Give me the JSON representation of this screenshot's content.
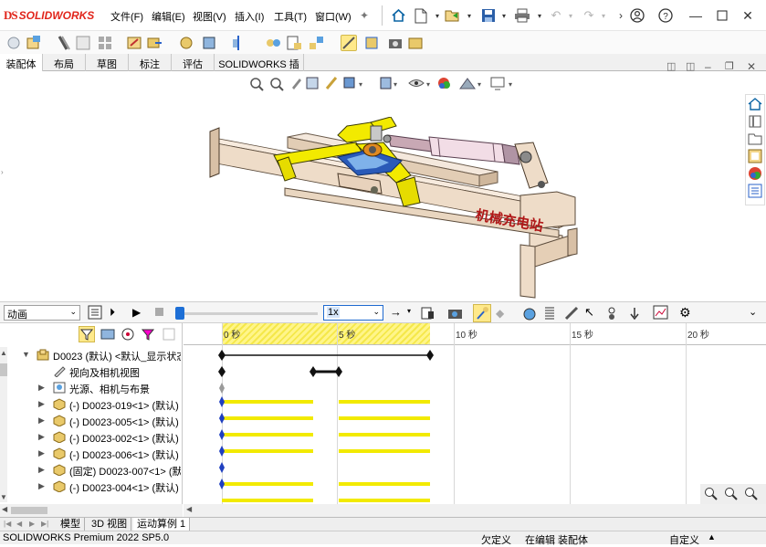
{
  "app": {
    "logo_ds": "DS",
    "logo_text": "SOLIDWORKS",
    "menus": [
      "文件(F)",
      "编辑(E)",
      "视图(V)",
      "插入(I)",
      "工具(T)",
      "窗口(W)"
    ]
  },
  "tabs": [
    "装配体",
    "布局",
    "草图",
    "标注",
    "评估",
    "SOLIDWORKS 插件"
  ],
  "viewport": {
    "watermark": "机械充电站"
  },
  "motion": {
    "study_type": "动画",
    "speed": "1x",
    "ticks": [
      "0 秒",
      "5 秒",
      "10 秒",
      "15 秒",
      "20 秒"
    ]
  },
  "tree": {
    "rows": [
      {
        "label": "D0023 (默认) <默认_显示状态",
        "arrow": "▼",
        "icon": "assembly"
      },
      {
        "label": "视向及相机视图",
        "arrow": "",
        "icon": "camera"
      },
      {
        "label": "光源、相机与布景",
        "arrow": "▶",
        "icon": "lights"
      },
      {
        "label": "(-) D0023-019<1> (默认)",
        "arrow": "▶",
        "icon": "part"
      },
      {
        "label": "(-) D0023-005<1> (默认)",
        "arrow": "▶",
        "icon": "part"
      },
      {
        "label": "(-) D0023-002<1> (默认)",
        "arrow": "▶",
        "icon": "part"
      },
      {
        "label": "(-) D0023-006<1> (默认)",
        "arrow": "▶",
        "icon": "part"
      },
      {
        "label": "(固定) D0023-007<1> (默",
        "arrow": "▶",
        "icon": "part"
      },
      {
        "label": "(-) D0023-004<1> (默认)",
        "arrow": "▶",
        "icon": "part"
      }
    ]
  },
  "bottom_tabs": [
    "模型",
    "3D 视图",
    "运动算例 1"
  ],
  "status": {
    "product": "SOLIDWORKS Premium 2022 SP5.0",
    "s1": "欠定义",
    "s2": "在编辑 装配体",
    "s3": "自定义"
  },
  "colors": {
    "accent_yellow": "#f2ea00",
    "key_blue": "#1f3fbf",
    "frame_beige": "#eedcc8",
    "logo_red": "#e1251b"
  }
}
